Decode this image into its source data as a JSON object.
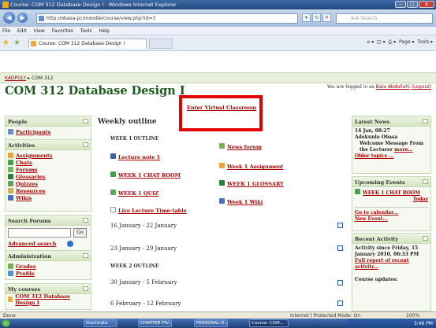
{
  "window": {
    "title": "Course: COM 312 Database Design I - Windows Internet Explorer"
  },
  "browser": {
    "url": "http://obasa-pc/moodle/course/view.php?id=3",
    "search_placeholder": "Ask Search",
    "menu": [
      "File",
      "Edit",
      "View",
      "Favorites",
      "Tools",
      "Help"
    ],
    "tab_title": "Course: COM 312 Database Design I",
    "cmd": [
      "Page",
      "Tools"
    ]
  },
  "page": {
    "login_text": "You are logged in as",
    "login_user": "Bala Abdullahi",
    "logout": "(Logout)",
    "course_title": "COM 312 Database Design I",
    "breadcrumb_home": "KADPOLY",
    "breadcrumb_current": "COM 312",
    "virtual_classroom": "Enter Virtual Classroom",
    "weekly_outline": "Weekly outline"
  },
  "left": {
    "people": {
      "title": "People",
      "items": [
        "Participants"
      ]
    },
    "activities": {
      "title": "Activities",
      "items": [
        "Assignments",
        "Chats",
        "Forums",
        "Glossaries",
        "Quizzes",
        "Resources",
        "Wikis"
      ]
    },
    "search": {
      "title": "Search Forums",
      "go": "Go",
      "advanced": "Advanced search"
    },
    "admin": {
      "title": "Administration",
      "items": [
        "Grades",
        "Profile"
      ]
    },
    "mycourses": {
      "title": "My courses",
      "items": [
        "COM 312 Database Design I"
      ]
    }
  },
  "main": {
    "week1_outline": "WEEK 1 OUTLINE",
    "news_forum": "News forum",
    "lecture_note": "Lecture note 1",
    "week1_assignment": "Week 1 Assignment",
    "week1_chat": "WEEK 1 CHAT ROOM",
    "week1_glossary": "WEEK 1 GLOSSARY",
    "week1_quiz": "WEEK 1 QUIZ",
    "week1_wiki": "Week 1 Wiki",
    "live_timetable": "Live Lecture Time-table",
    "dates": [
      "16 January - 22 January",
      "23 January - 29 January",
      "30 January - 5 February",
      "6 February - 12 February"
    ],
    "week2_outline": "WEEK 2 OUTLINE"
  },
  "right": {
    "news": {
      "title": "Latest News",
      "date": "14 Jan, 08:27",
      "author": "Adekunle Obasa",
      "text": "Welcome Message From the Lecturer",
      "more": "more...",
      "older": "Older topics ..."
    },
    "events": {
      "title": "Upcoming Events",
      "event": "WEEK 1 CHAT ROOM",
      "when": "Today",
      "calendar": "Go to calendar...",
      "new_event": "New Event..."
    },
    "activity": {
      "title": "Recent Activity",
      "since": "Activity since Friday, 15 January 2010, 06:33 PM",
      "report": "Full report of recent activity...",
      "updates": "Course updates:"
    }
  },
  "status": {
    "zone": "Internet | Protected Mode: On",
    "zoom": "100%"
  },
  "taskbar": {
    "items": [
      "Illuminate",
      "CHAPTER FIV...",
      "PERSONAL D...",
      "Course: COM..."
    ],
    "time": "3:46 PM"
  },
  "colors": {
    "accent_red": "#aa0000",
    "course_green": "#1d5a1d",
    "highlight_box": "#e00000"
  }
}
